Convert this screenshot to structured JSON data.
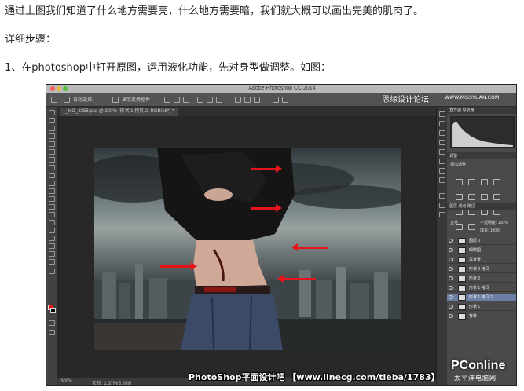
{
  "article": {
    "line1": "通过上图我们知道了什么地方需要亮，什么地方需要暗，我们就大概可以画出完美的肌肉了。",
    "line2": "详细步骤：",
    "line3": "1、在photoshop中打开原图，运用液化功能，先对身型做调整。如图："
  },
  "photoshop": {
    "window_title": "Adobe Photoshop CC 2014",
    "options": {
      "auto_select": "自动选择:",
      "show_transform": "显示变换控件"
    },
    "document_tab": "_MG_3256.psd @ 300% (形状 1 拷贝 2, RGB/16*) *",
    "status": {
      "zoom": "300%",
      "doc": "文档: 1.37M/5.89M"
    },
    "panels": {
      "histogram_tabs": "直方图   导航器",
      "adjust_tab": "调整",
      "adjust_title": "添加调整",
      "layers_tabs": "图层   通道   路径",
      "blend_mode": "正常",
      "opacity": "不透明度: 100%",
      "fill": "填充: 100%"
    },
    "layers": [
      {
        "name": "图层 0"
      },
      {
        "name": "眼睛图"
      },
      {
        "name": "黑背景"
      },
      {
        "name": "形状 2 拷贝"
      },
      {
        "name": "形状 2"
      },
      {
        "name": "形状 1 拷贝"
      },
      {
        "name": "形状 1 拷贝 2"
      },
      {
        "name": "形状 1"
      },
      {
        "name": "背景"
      }
    ]
  },
  "watermarks": {
    "top": "思缘设计论坛",
    "top_site": "WWW.MISSYUAN.COM",
    "brand": "PConline",
    "brand_sub": "太平洋电脑网",
    "caption": "PhotoShop平面设计吧 【www.linecg.com/tieba/1783】"
  },
  "colors": {
    "arrow": "#e8141c",
    "foreground": "#e8141c",
    "background": "#000000",
    "selected_layer": "#6b7fa6"
  },
  "icons": {
    "tools": "photoshop-tool-icons",
    "eye": "eye-icon"
  }
}
